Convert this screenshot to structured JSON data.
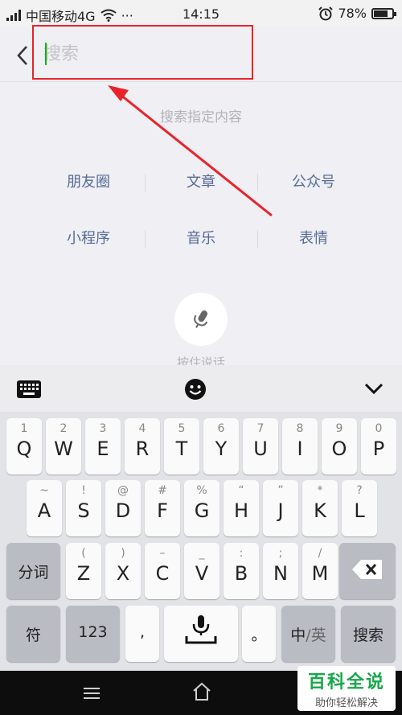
{
  "status": {
    "carrier": "中国移动4G",
    "signal_icon": "signal-bars-icon",
    "wifi_icon": "wifi-icon",
    "more": "···",
    "time": "14:15",
    "alarm_icon": "alarm-clock-icon",
    "battery_percent": "78%",
    "battery_level": 0.78
  },
  "search": {
    "placeholder": "搜索",
    "value": "",
    "back_icon": "chevron-left-icon"
  },
  "hint": "搜索指定内容",
  "categories": [
    "朋友圈",
    "文章",
    "公众号",
    "小程序",
    "音乐",
    "表情"
  ],
  "voice": {
    "label": "按住说话",
    "icon": "microphone-icon"
  },
  "colors": {
    "accent_green": "#09bb07",
    "link_blue": "#576b95",
    "annotation_red": "#e8232a"
  },
  "keyboard": {
    "toolbar_icons": [
      "keyboard-icon",
      "emoji-icon",
      "chevron-down-icon"
    ],
    "row1": [
      {
        "num": "1",
        "letter": "Q"
      },
      {
        "num": "2",
        "letter": "W"
      },
      {
        "num": "3",
        "letter": "E"
      },
      {
        "num": "4",
        "letter": "R"
      },
      {
        "num": "5",
        "letter": "T"
      },
      {
        "num": "6",
        "letter": "Y"
      },
      {
        "num": "7",
        "letter": "U"
      },
      {
        "num": "8",
        "letter": "I"
      },
      {
        "num": "9",
        "letter": "O"
      },
      {
        "num": "0",
        "letter": "P"
      }
    ],
    "row2": [
      {
        "num": "~",
        "letter": "A"
      },
      {
        "num": "!",
        "letter": "S"
      },
      {
        "num": "@",
        "letter": "D"
      },
      {
        "num": "#",
        "letter": "F"
      },
      {
        "num": "%",
        "letter": "G"
      },
      {
        "num": "“",
        "letter": "H"
      },
      {
        "num": "”",
        "letter": "J"
      },
      {
        "num": "*",
        "letter": "K"
      },
      {
        "num": "?",
        "letter": "L"
      }
    ],
    "row3": [
      {
        "num": "(",
        "letter": "Z"
      },
      {
        "num": ")",
        "letter": "X"
      },
      {
        "num": "–",
        "letter": "C"
      },
      {
        "num": "_",
        "letter": "V"
      },
      {
        "num": ":",
        "letter": "B"
      },
      {
        "num": ";",
        "letter": "N"
      },
      {
        "num": "/",
        "letter": "M"
      }
    ],
    "fenci": "分词",
    "fu": "符",
    "num123": "123",
    "comma": ",",
    "period": "。",
    "lang_zh": "中",
    "lang_sep": "/",
    "lang_en": "英",
    "search_key": "搜索"
  },
  "brand": {
    "title": "百科全说",
    "subtitle": "助你轻松解决"
  }
}
